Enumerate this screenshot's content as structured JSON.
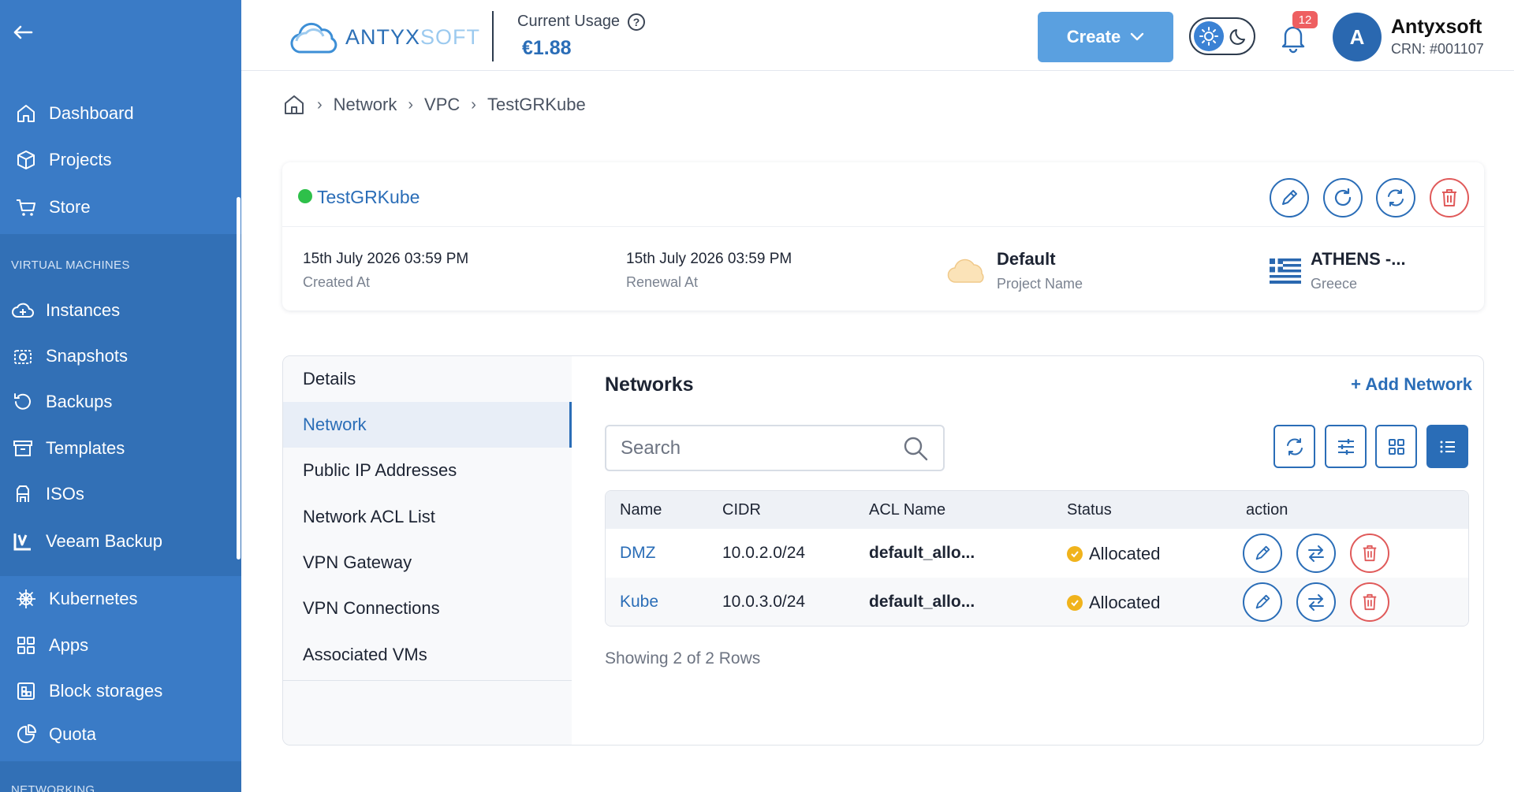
{
  "sidebar": {
    "items": [
      {
        "label": "Dashboard"
      },
      {
        "label": "Projects"
      },
      {
        "label": "Store"
      },
      {
        "label": "Instances"
      },
      {
        "label": "Snapshots"
      },
      {
        "label": "Backups"
      },
      {
        "label": "Templates"
      },
      {
        "label": "ISOs"
      },
      {
        "label": "Veeam Backup"
      },
      {
        "label": "Kubernetes"
      },
      {
        "label": "Apps"
      },
      {
        "label": "Block storages"
      },
      {
        "label": "Quota"
      }
    ],
    "section_vm": "VIRTUAL MACHINES",
    "section_net": "NETWORKING"
  },
  "topbar": {
    "logo": {
      "a": "ANTYX",
      "b": "SOFT"
    },
    "usage_label": "Current Usage",
    "usage_value": "€1.88",
    "create_label": "Create",
    "notifications": "12",
    "avatar_initial": "A",
    "user_name": "Antyxsoft",
    "user_crn": "CRN: #001107"
  },
  "breadcrumb": [
    "Network",
    "VPC",
    "TestGRKube"
  ],
  "summary": {
    "name": "TestGRKube",
    "created_at": "15th July 2026 03:59 PM",
    "created_label": "Created At",
    "renewal_at": "15th July 2026 03:59 PM",
    "renewal_label": "Renewal At",
    "project": "Default",
    "project_label": "Project Name",
    "zone": "ATHENS -...",
    "country": "Greece"
  },
  "subnav": [
    "Details",
    "Network",
    "Public IP Addresses",
    "Network ACL List",
    "VPN Gateway",
    "VPN Connections",
    "Associated VMs"
  ],
  "networks": {
    "title": "Networks",
    "add_label": "+ Add Network",
    "search_placeholder": "Search",
    "columns": [
      "Name",
      "CIDR",
      "ACL Name",
      "Status",
      "action"
    ],
    "rows": [
      {
        "name": "DMZ",
        "cidr": "10.0.2.0/24",
        "acl": "default_allo...",
        "status": "Allocated"
      },
      {
        "name": "Kube",
        "cidr": "10.0.3.0/24",
        "acl": "default_allo...",
        "status": "Allocated"
      }
    ],
    "footer": "Showing 2 of 2 Rows"
  },
  "colors": {
    "sidebar": "#3a7bc6",
    "accent": "#2a6db7",
    "danger": "#e05a5a",
    "status_active": "#2ec04a",
    "status_allocated": "#f0b31c"
  }
}
